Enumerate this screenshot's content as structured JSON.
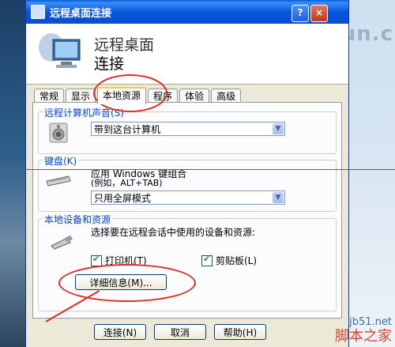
{
  "window": {
    "title": "远程桌面连接"
  },
  "header": {
    "line1": "远程桌面",
    "line2": "连接"
  },
  "titlebar_buttons": {
    "help": "?",
    "close": "×"
  },
  "tabs": [
    {
      "label": "常规"
    },
    {
      "label": "显示"
    },
    {
      "label": "本地资源",
      "active": true
    },
    {
      "label": "程序"
    },
    {
      "label": "体验"
    },
    {
      "label": "高级"
    }
  ],
  "sound_group": {
    "label": "远程计算机声音(S)",
    "select_value": "带到这台计算机"
  },
  "keyboard_group": {
    "label": "键盘(K)",
    "desc_line1": "应用 Windows 键组合",
    "desc_line2": "(例如，ALT+TAB)",
    "select_value": "只用全屏模式"
  },
  "devices_group": {
    "label": "本地设备和资源",
    "desc": "选择要在远程会话中使用的设备和资源:",
    "printer_label": "打印机(T)",
    "clipboard_label": "剪贴板(L)",
    "printer_checked": true,
    "clipboard_checked": true,
    "details_button": "详细信息(M)..."
  },
  "footer": {
    "connect": "连接(N)",
    "cancel": "取消",
    "help": "帮助(H)"
  },
  "watermarks": {
    "top": "itsun.c",
    "site": "jb51.net",
    "site2": "脚本之家"
  }
}
